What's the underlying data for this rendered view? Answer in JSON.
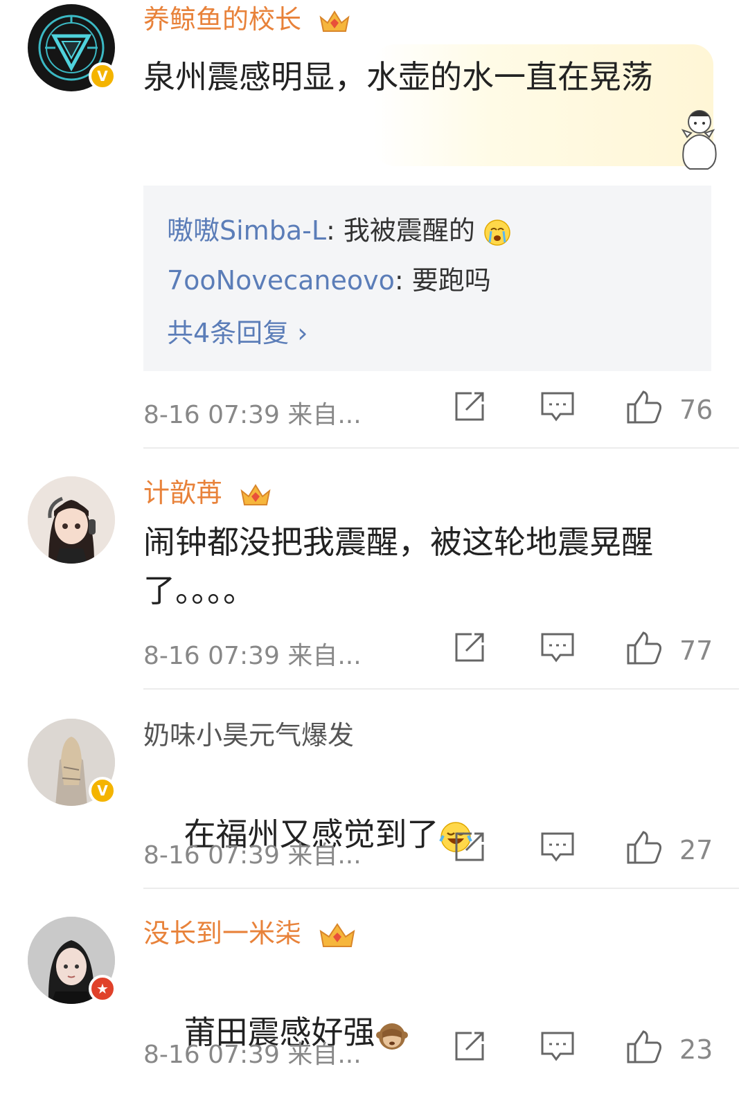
{
  "comments": [
    {
      "username": "养鲸鱼的校长",
      "text": "泉州震感明显，水壶的水一直在晃荡",
      "time": "8-16 07:39",
      "source": "来自...",
      "likes": "76",
      "replies": [
        {
          "user": "嗷嗷Simba-L",
          "text": ": 我被震醒的"
        },
        {
          "user": "7ooNovecaneovo",
          "text": ": 要跑吗"
        }
      ],
      "more_replies": "共4条回复 ›"
    },
    {
      "username": "计歆苒",
      "text": "闹钟都没把我震醒，被这轮地震晃醒了。。。。",
      "time": "8-16 07:39",
      "source": "来自...",
      "likes": "77"
    },
    {
      "username": "奶味小昊元气爆发",
      "text": "在福州又感觉到了",
      "time": "8-16 07:39",
      "source": "来自...",
      "likes": "27"
    },
    {
      "username": "没长到一米柒",
      "text": "莆田震感好强",
      "time": "8-16 07:39",
      "source": "来自...",
      "likes": "23"
    }
  ],
  "icons": {
    "share": "share-icon",
    "comment": "comment-icon",
    "like": "thumbs-up-icon",
    "verified": "verified-badge-icon",
    "crown": "crown-icon"
  },
  "colors": {
    "username_vip": "#e8823a",
    "reply_user": "#5b7db8",
    "meta": "#888888",
    "reply_bg": "#f4f5f7"
  }
}
